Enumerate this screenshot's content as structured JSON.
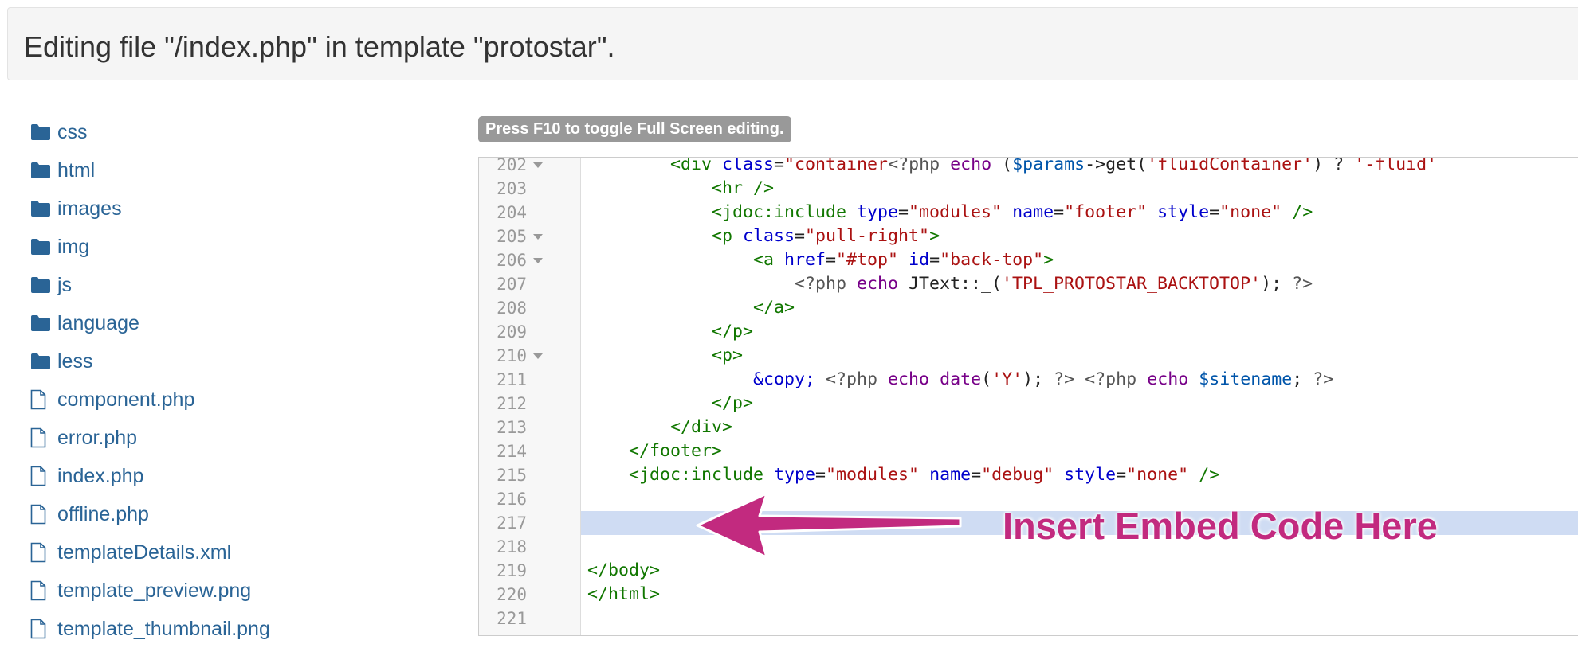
{
  "header": {
    "title": "Editing file \"/index.php\" in template \"protostar\"."
  },
  "tree": {
    "items": [
      {
        "type": "folder",
        "label": "css"
      },
      {
        "type": "folder",
        "label": "html"
      },
      {
        "type": "folder",
        "label": "images"
      },
      {
        "type": "folder",
        "label": "img"
      },
      {
        "type": "folder",
        "label": "js"
      },
      {
        "type": "folder",
        "label": "language"
      },
      {
        "type": "folder",
        "label": "less"
      },
      {
        "type": "file",
        "label": "component.php"
      },
      {
        "type": "file",
        "label": "error.php"
      },
      {
        "type": "file",
        "label": "index.php"
      },
      {
        "type": "file",
        "label": "offline.php"
      },
      {
        "type": "file",
        "label": "templateDetails.xml"
      },
      {
        "type": "file",
        "label": "template_preview.png"
      },
      {
        "type": "file",
        "label": "template_thumbnail.png"
      }
    ]
  },
  "editor": {
    "hint": "Press F10 to toggle Full Screen editing.",
    "active_line": 217,
    "lines": [
      {
        "num": "202",
        "fold": true,
        "tokens": [
          [
            "tag",
            "        <div "
          ],
          [
            "attr",
            "class"
          ],
          [
            "plain",
            "="
          ],
          [
            "str",
            "\"container"
          ],
          [
            "meta",
            "<?php "
          ],
          [
            "kw",
            "echo"
          ],
          [
            "plain",
            " ("
          ],
          [
            "var",
            "$params"
          ],
          [
            "plain",
            "->get("
          ],
          [
            "str",
            "'fluidContainer'"
          ],
          [
            "plain",
            ") ? "
          ],
          [
            "str",
            "'-fluid'"
          ]
        ]
      },
      {
        "num": "203",
        "fold": false,
        "tokens": [
          [
            "tag",
            "            <hr />"
          ]
        ]
      },
      {
        "num": "204",
        "fold": false,
        "tokens": [
          [
            "tag",
            "            <jdoc:include "
          ],
          [
            "attr",
            "type"
          ],
          [
            "plain",
            "="
          ],
          [
            "str",
            "\"modules\""
          ],
          [
            "plain",
            " "
          ],
          [
            "attr",
            "name"
          ],
          [
            "plain",
            "="
          ],
          [
            "str",
            "\"footer\""
          ],
          [
            "plain",
            " "
          ],
          [
            "attr",
            "style"
          ],
          [
            "plain",
            "="
          ],
          [
            "str",
            "\"none\""
          ],
          [
            "tag",
            " />"
          ]
        ]
      },
      {
        "num": "205",
        "fold": true,
        "tokens": [
          [
            "tag",
            "            <p "
          ],
          [
            "attr",
            "class"
          ],
          [
            "plain",
            "="
          ],
          [
            "str",
            "\"pull-right\""
          ],
          [
            "tag",
            ">"
          ]
        ]
      },
      {
        "num": "206",
        "fold": true,
        "tokens": [
          [
            "tag",
            "                <a "
          ],
          [
            "attr",
            "href"
          ],
          [
            "plain",
            "="
          ],
          [
            "str",
            "\"#top\""
          ],
          [
            "plain",
            " "
          ],
          [
            "attr",
            "id"
          ],
          [
            "plain",
            "="
          ],
          [
            "str",
            "\"back-top\""
          ],
          [
            "tag",
            ">"
          ]
        ]
      },
      {
        "num": "207",
        "fold": false,
        "tokens": [
          [
            "meta",
            "                    <?php "
          ],
          [
            "kw",
            "echo"
          ],
          [
            "plain",
            " JText::_("
          ],
          [
            "str",
            "'TPL_PROTOSTAR_BACKTOTOP'"
          ],
          [
            "plain",
            "); "
          ],
          [
            "meta",
            "?>"
          ]
        ]
      },
      {
        "num": "208",
        "fold": false,
        "tokens": [
          [
            "tag",
            "                </a>"
          ]
        ]
      },
      {
        "num": "209",
        "fold": false,
        "tokens": [
          [
            "tag",
            "            </p>"
          ]
        ]
      },
      {
        "num": "210",
        "fold": true,
        "tokens": [
          [
            "tag",
            "            <p>"
          ]
        ]
      },
      {
        "num": "211",
        "fold": false,
        "tokens": [
          [
            "attr",
            "                &copy;"
          ],
          [
            "plain",
            " "
          ],
          [
            "meta",
            "<?php "
          ],
          [
            "kw",
            "echo"
          ],
          [
            "plain",
            " "
          ],
          [
            "kw",
            "date"
          ],
          [
            "plain",
            "("
          ],
          [
            "str",
            "'Y'"
          ],
          [
            "plain",
            "); "
          ],
          [
            "meta",
            "?>"
          ],
          [
            "plain",
            " "
          ],
          [
            "meta",
            "<?php "
          ],
          [
            "kw",
            "echo"
          ],
          [
            "plain",
            " "
          ],
          [
            "var",
            "$sitename"
          ],
          [
            "plain",
            "; "
          ],
          [
            "meta",
            "?>"
          ]
        ]
      },
      {
        "num": "212",
        "fold": false,
        "tokens": [
          [
            "tag",
            "            </p>"
          ]
        ]
      },
      {
        "num": "213",
        "fold": false,
        "tokens": [
          [
            "tag",
            "        </div>"
          ]
        ]
      },
      {
        "num": "214",
        "fold": false,
        "tokens": [
          [
            "tag",
            "    </footer>"
          ]
        ]
      },
      {
        "num": "215",
        "fold": false,
        "tokens": [
          [
            "tag",
            "    <jdoc:include "
          ],
          [
            "attr",
            "type"
          ],
          [
            "plain",
            "="
          ],
          [
            "str",
            "\"modules\""
          ],
          [
            "plain",
            " "
          ],
          [
            "attr",
            "name"
          ],
          [
            "plain",
            "="
          ],
          [
            "str",
            "\"debug\""
          ],
          [
            "plain",
            " "
          ],
          [
            "attr",
            "style"
          ],
          [
            "plain",
            "="
          ],
          [
            "str",
            "\"none\""
          ],
          [
            "tag",
            " />"
          ]
        ]
      },
      {
        "num": "216",
        "fold": false,
        "tokens": []
      },
      {
        "num": "217",
        "fold": false,
        "tokens": []
      },
      {
        "num": "218",
        "fold": false,
        "tokens": []
      },
      {
        "num": "219",
        "fold": false,
        "tokens": [
          [
            "tag",
            "</body>"
          ]
        ]
      },
      {
        "num": "220",
        "fold": false,
        "tokens": [
          [
            "tag",
            "</html>"
          ]
        ]
      },
      {
        "num": "221",
        "fold": false,
        "tokens": []
      }
    ]
  },
  "annotation": {
    "text": "Insert Embed Code Here",
    "color": "#c22a7f"
  },
  "colors": {
    "link": "#2a6496",
    "folder_icon": "#2a6496",
    "active_line_bg": "#cfdcf3",
    "hint_badge_bg": "#999999"
  }
}
